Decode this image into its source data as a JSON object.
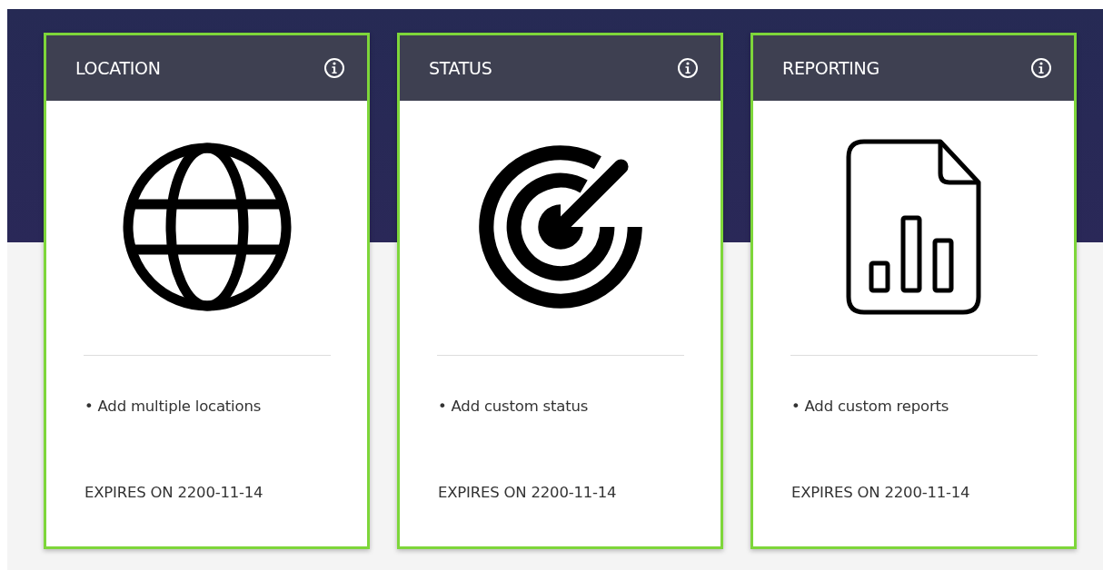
{
  "cards": [
    {
      "title": "LOCATION",
      "kind": "globe",
      "feature": "• Add multiple locations",
      "expiry": "EXPIRES ON 2200-11-14"
    },
    {
      "title": "STATUS",
      "kind": "radar",
      "feature": "• Add custom status",
      "expiry": "EXPIRES ON 2200-11-14"
    },
    {
      "title": "REPORTING",
      "kind": "report",
      "feature": "• Add custom reports",
      "expiry": "EXPIRES ON 2200-11-14"
    }
  ]
}
